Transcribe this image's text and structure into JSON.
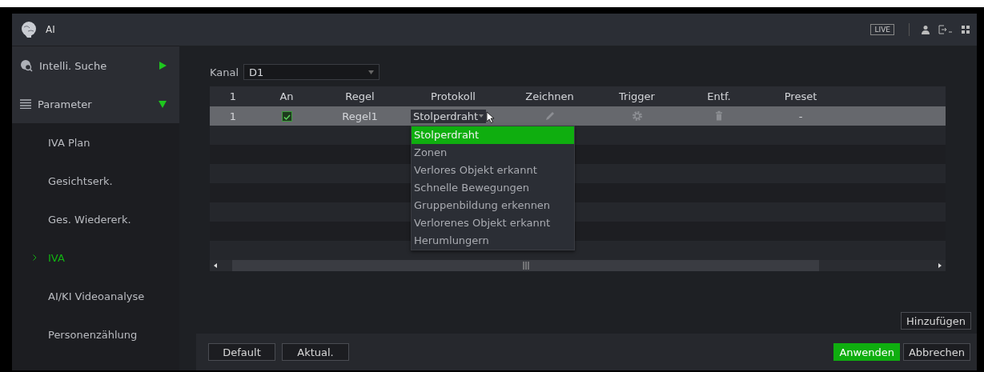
{
  "window": {
    "title": "AI",
    "live_badge": "LIVE"
  },
  "sidebar": {
    "items": [
      {
        "kind": "section",
        "label": "Intelli. Suche",
        "expanded": false
      },
      {
        "kind": "section",
        "label": "Parameter",
        "expanded": true
      },
      {
        "kind": "sub",
        "label": "IVA Plan",
        "selected": false
      },
      {
        "kind": "sub",
        "label": "Gesichtserk.",
        "selected": false
      },
      {
        "kind": "sub",
        "label": "Ges. Wiedererk.",
        "selected": false
      },
      {
        "kind": "sub",
        "label": "IVA",
        "selected": true
      },
      {
        "kind": "sub",
        "label": "AI/KI Videoanalyse",
        "selected": false
      },
      {
        "kind": "sub",
        "label": "Personenzählung",
        "selected": false
      }
    ]
  },
  "channel": {
    "label": "Kanal",
    "value": "D1"
  },
  "table": {
    "columns": [
      "1",
      "An",
      "Regel",
      "Protokoll",
      "Zeichnen",
      "Trigger",
      "Entf.",
      "Preset"
    ],
    "rows": [
      {
        "number": "1",
        "enabled": true,
        "rule": "Regel1",
        "protocol": "Stolperdraht",
        "preset": "-",
        "selected": true
      }
    ]
  },
  "protocol_dropdown": {
    "expanded": true,
    "options": [
      {
        "label": "Stolperdraht",
        "selected": true
      },
      {
        "label": "Zonen",
        "selected": false
      },
      {
        "label": "Verlores Objekt erkannt",
        "selected": false
      },
      {
        "label": "Schnelle Bewegungen",
        "selected": false
      },
      {
        "label": "Gruppenbildung erkennen",
        "selected": false
      },
      {
        "label": "Verlorenes Objekt erkannt",
        "selected": false
      },
      {
        "label": "Herumlungern",
        "selected": false
      }
    ]
  },
  "add_button": "Hinzufügen",
  "footer": {
    "left": [
      "Default",
      "Aktual."
    ],
    "right": [
      {
        "label": "Anwenden",
        "kind": "primary"
      },
      {
        "label": "Abbrechen",
        "kind": "secondary"
      }
    ]
  }
}
